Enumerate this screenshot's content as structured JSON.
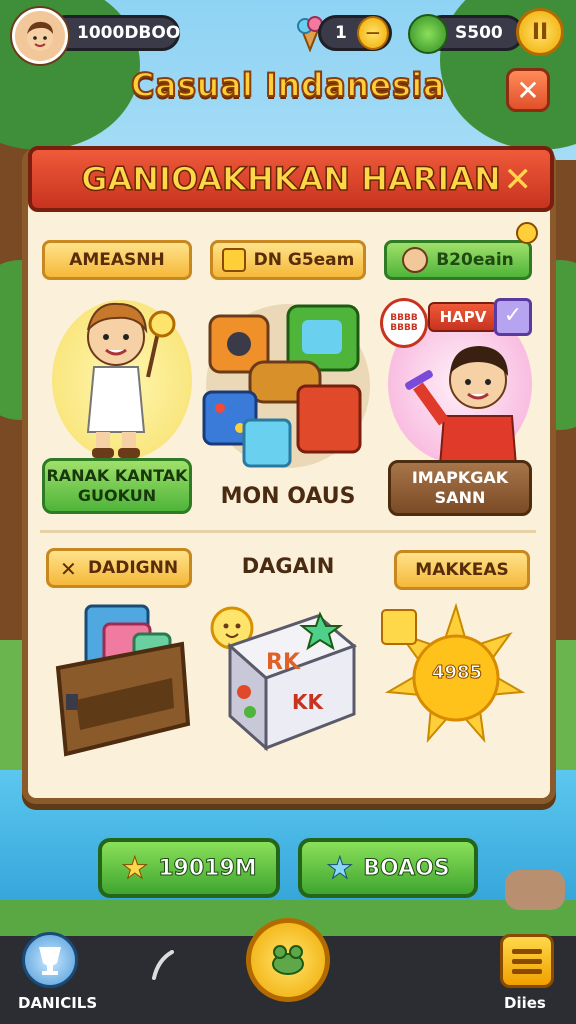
{
  "header": {
    "player_score": "1000DBOO",
    "gem_count": "1",
    "cash": "S500",
    "pause_label": "II",
    "game_title": "Casual Indanesia",
    "close_label": "✕"
  },
  "panel": {
    "title": "GANIOAKHKAN HARIAN",
    "close_label": "✕",
    "top_tabs": [
      "AMEASNH",
      "DN G5eam",
      "B20eain"
    ],
    "cards_row1": [
      {
        "label_line1": "RANAK KANTAK",
        "label_line2": "GUOKUN"
      },
      {
        "label": "MON OAUS"
      },
      {
        "badge": "HAPV",
        "speech": "BBBB BBBB",
        "label_line1": "IMAPKGAK",
        "label_line2": "SANN"
      }
    ],
    "row2_tabs": [
      "DADIGNN",
      "DAGAIN",
      "MAKKEAS"
    ],
    "sun_label": "4985",
    "cube_text_1": "RK",
    "cube_text_2": "KK"
  },
  "actions": {
    "left_button": "19019M",
    "right_button": "BOAOS"
  },
  "navbar": {
    "left_label": "DANICILS",
    "right_label": "Diies"
  },
  "colors": {
    "accent": "#4fb43a",
    "ribbon": "#d83a22",
    "panel_bg": "#fbf1da",
    "gold": "#ffcf3a"
  },
  "icons": {
    "left_nav": "trophy-icon",
    "center_nav": "frog-icon",
    "right_nav": "menu-list-icon",
    "left_button": "star-icon",
    "right_button": "star-icon"
  }
}
